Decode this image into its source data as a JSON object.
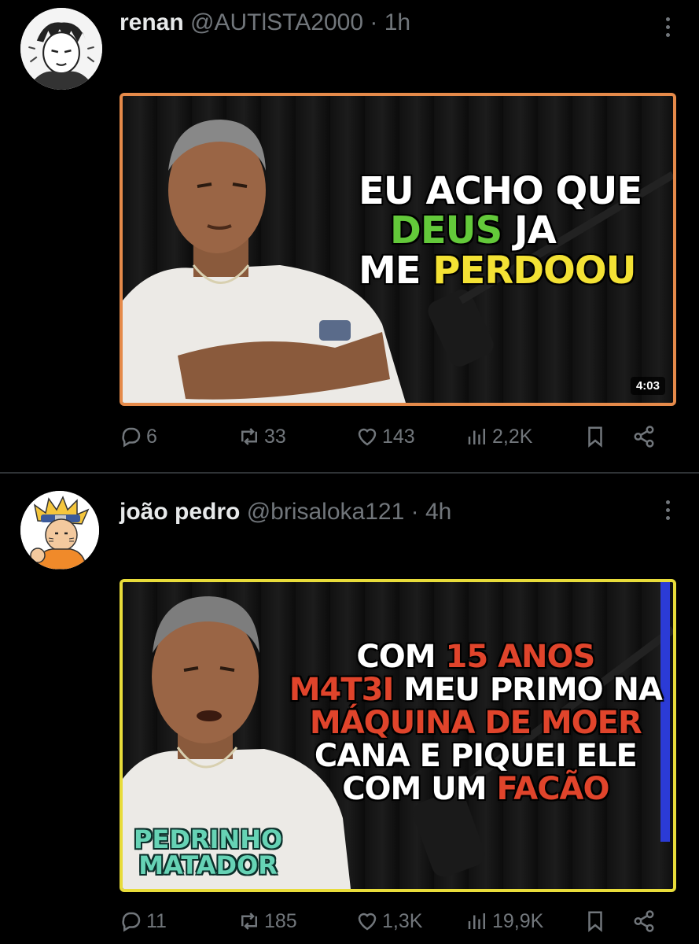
{
  "posts": [
    {
      "display_name": "renan",
      "handle": "@AUTlSTA2000",
      "separator": "·",
      "time": "1h",
      "video": {
        "caption_lines": [
          [
            {
              "text": "EU ACHO QUE",
              "color": "#ffffff"
            }
          ],
          [
            {
              "text": "DEUS",
              "color": "#63c93a"
            },
            {
              "text": " JA",
              "color": "#ffffff"
            }
          ],
          [
            {
              "text": "ME ",
              "color": "#ffffff"
            },
            {
              "text": "PERDOOU",
              "color": "#f3e134"
            }
          ]
        ],
        "duration": "4:03",
        "border_color": "#e58a4a"
      },
      "stats": {
        "replies": "6",
        "reposts": "33",
        "likes": "143",
        "views": "2,2K"
      }
    },
    {
      "display_name": "joão pedro",
      "handle": "@brisaloka121",
      "separator": "·",
      "time": "4h",
      "video": {
        "caption_lines": [
          [
            {
              "text": "COM ",
              "color": "#ffffff"
            },
            {
              "text": "15 ANOS",
              "color": "#e0442b"
            }
          ],
          [
            {
              "text": "M4T3I",
              "color": "#e0442b"
            },
            {
              "text": " MEU PRIMO NA",
              "color": "#ffffff"
            }
          ],
          [
            {
              "text": "MÁQUINA DE MOER",
              "color": "#e0442b"
            }
          ],
          [
            {
              "text": "CANA E PIQUEI ELE",
              "color": "#ffffff"
            }
          ],
          [
            {
              "text": "COM UM ",
              "color": "#ffffff"
            },
            {
              "text": "FACÃO",
              "color": "#e0442b"
            }
          ]
        ],
        "name_tag": [
          "PEDRINHO",
          "MATADOR"
        ],
        "border_color": "#e8dc3a"
      },
      "stats": {
        "replies": "11",
        "reposts": "185",
        "likes": "1,3K",
        "views": "19,9K"
      }
    }
  ],
  "icons": {
    "reply": "speech-bubble-icon",
    "repost": "repost-arrows-icon",
    "like": "heart-icon",
    "views": "bar-chart-icon",
    "bookmark": "bookmark-icon",
    "share": "share-icon",
    "more": "more-vertical-icon"
  },
  "colors": {
    "background": "#000000",
    "muted": "#71767b",
    "text": "#e7e9ea"
  }
}
